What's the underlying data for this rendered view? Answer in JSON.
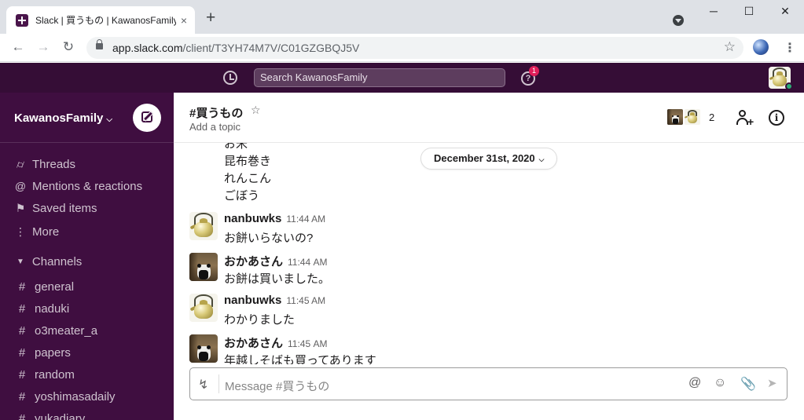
{
  "browser": {
    "tab_title": "Slack | 買うもの | KawanosFamily",
    "tab_close": "×",
    "new_tab": "+",
    "url_host": "app.slack.com",
    "url_path": "/client/T3YH74M7V/C01GZGBQJ5V",
    "minimize": "─",
    "maximize": "☐",
    "close": "✕"
  },
  "slack_top": {
    "search_placeholder": "Search KawanosFamily",
    "help_badge": "1"
  },
  "sidebar": {
    "workspace": "KawanosFamily",
    "nav": [
      {
        "label": "Threads",
        "icon": "threads-icon"
      },
      {
        "label": "Mentions & reactions",
        "icon": "at-icon"
      },
      {
        "label": "Saved items",
        "icon": "bookmark-icon"
      },
      {
        "label": "More",
        "icon": "more-icon"
      }
    ],
    "channels_label": "Channels",
    "channels": [
      "general",
      "naduki",
      "o3meater_a",
      "papers",
      "random",
      "yoshimasadaily",
      "yukadiary"
    ]
  },
  "channel": {
    "name": "#買うもの",
    "topic": "Add a topic",
    "member_count": "2"
  },
  "messages": {
    "continued": [
      "お米",
      "昆布巻き",
      "れんこん",
      "ごぼう"
    ],
    "date_divider": "December 31st, 2020",
    "items": [
      {
        "author": "nanbuwks",
        "time": "11:44 AM",
        "text": "お餅いらないの?",
        "avatar": "kettle"
      },
      {
        "author": "おかあさん",
        "time": "11:44 AM",
        "text": "お餅は買いました。",
        "avatar": "panda"
      },
      {
        "author": "nanbuwks",
        "time": "11:45 AM",
        "text": "わかりました",
        "avatar": "kettle"
      },
      {
        "author": "おかあさん",
        "time": "11:45 AM",
        "text": "年越しそばも買ってあります",
        "avatar": "panda"
      }
    ]
  },
  "composer": {
    "placeholder": "Message #買うもの"
  },
  "colors": {
    "sidebar": "#3f0e40",
    "topbar": "#350d36",
    "badge": "#e01e5a",
    "presence": "#2bac76"
  }
}
